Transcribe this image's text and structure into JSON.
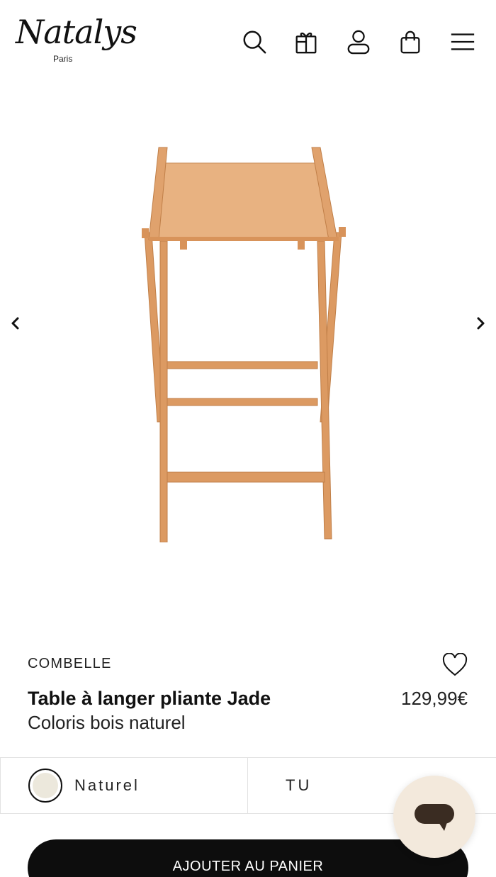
{
  "header": {
    "logo_text": "Natalys",
    "logo_subtext": "Paris",
    "icons": [
      "search-icon",
      "gift-icon",
      "user-icon",
      "shopping-bag-icon",
      "menu-icon"
    ]
  },
  "gallery": {
    "prev_icon": "chevron-left-icon",
    "next_icon": "chevron-right-icon"
  },
  "product": {
    "brand": "COMBELLE",
    "title": "Table à langer pliante Jade",
    "subtitle": "Coloris bois naturel",
    "price": "129,99€"
  },
  "options": {
    "color_label": "Naturel",
    "swatch_color": "#ece8dc",
    "size_label": "TU"
  },
  "cart": {
    "button_label": "AJOUTER AU PANIER"
  },
  "colors": {
    "accent": "#0d0d0d",
    "chat_bg": "#f3e9dc",
    "wood": "#e2a36f"
  }
}
